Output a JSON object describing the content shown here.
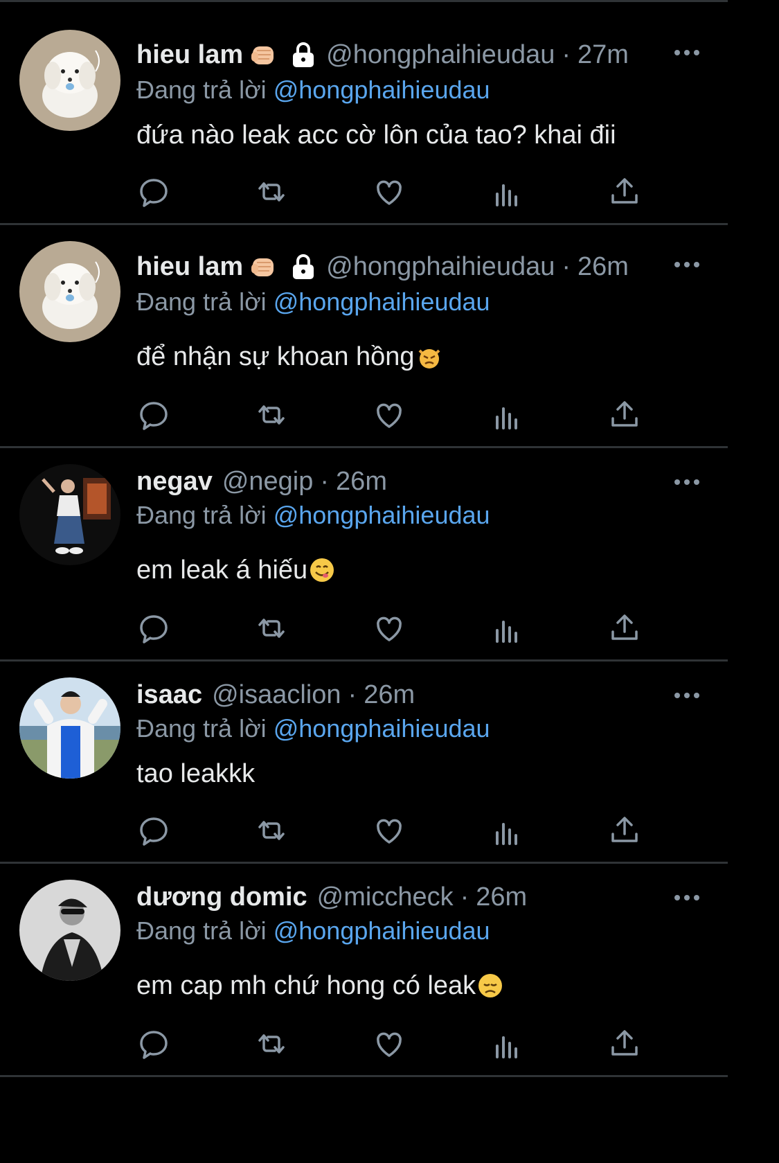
{
  "reply_prefix": "Đang trả lời",
  "tweets": [
    {
      "name": "hieu lam",
      "handle": "@hongphaihieudau",
      "separator": "·",
      "time": "27m",
      "reply_to": "@hongphaihieudau",
      "text": "đứa nào leak acc cờ lôn của tao? khai đii",
      "badges": [
        "fist-emoji",
        "lock-icon"
      ],
      "avatar": "white-puppy"
    },
    {
      "name": "hieu lam",
      "handle": "@hongphaihieudau",
      "separator": "·",
      "time": "26m",
      "reply_to": "@hongphaihieudau",
      "text": "để nhận sự khoan hồng",
      "text_emoji": "angry-cat-emoji",
      "badges": [
        "fist-emoji",
        "lock-icon"
      ],
      "avatar": "white-puppy"
    },
    {
      "name": "negav",
      "handle": "@negip",
      "separator": "·",
      "time": "26m",
      "reply_to": "@hongphaihieudau",
      "text": "em leak á hiếu",
      "text_emoji": "yum-face-emoji",
      "avatar": "person-dark"
    },
    {
      "name": "isaac",
      "handle": "@isaaclion",
      "separator": "·",
      "time": "26m",
      "reply_to": "@hongphaihieudau",
      "text": "tao leakkk",
      "avatar": "person-blue-shirt"
    },
    {
      "name": "dương domic",
      "handle": "@miccheck",
      "separator": "·",
      "time": "26m",
      "reply_to": "@hongphaihieudau",
      "text": "em cap mh chứ hong có leak",
      "text_emoji": "disappointed-face-emoji",
      "avatar": "person-bw"
    }
  ],
  "actions": [
    "reply-icon",
    "retweet-icon",
    "like-icon",
    "views-icon",
    "share-icon"
  ],
  "colors": {
    "background": "#000000",
    "text": "#e7e9ea",
    "muted": "#8b98a5",
    "mention": "#5aa6ee",
    "separator": "#2f3336"
  }
}
